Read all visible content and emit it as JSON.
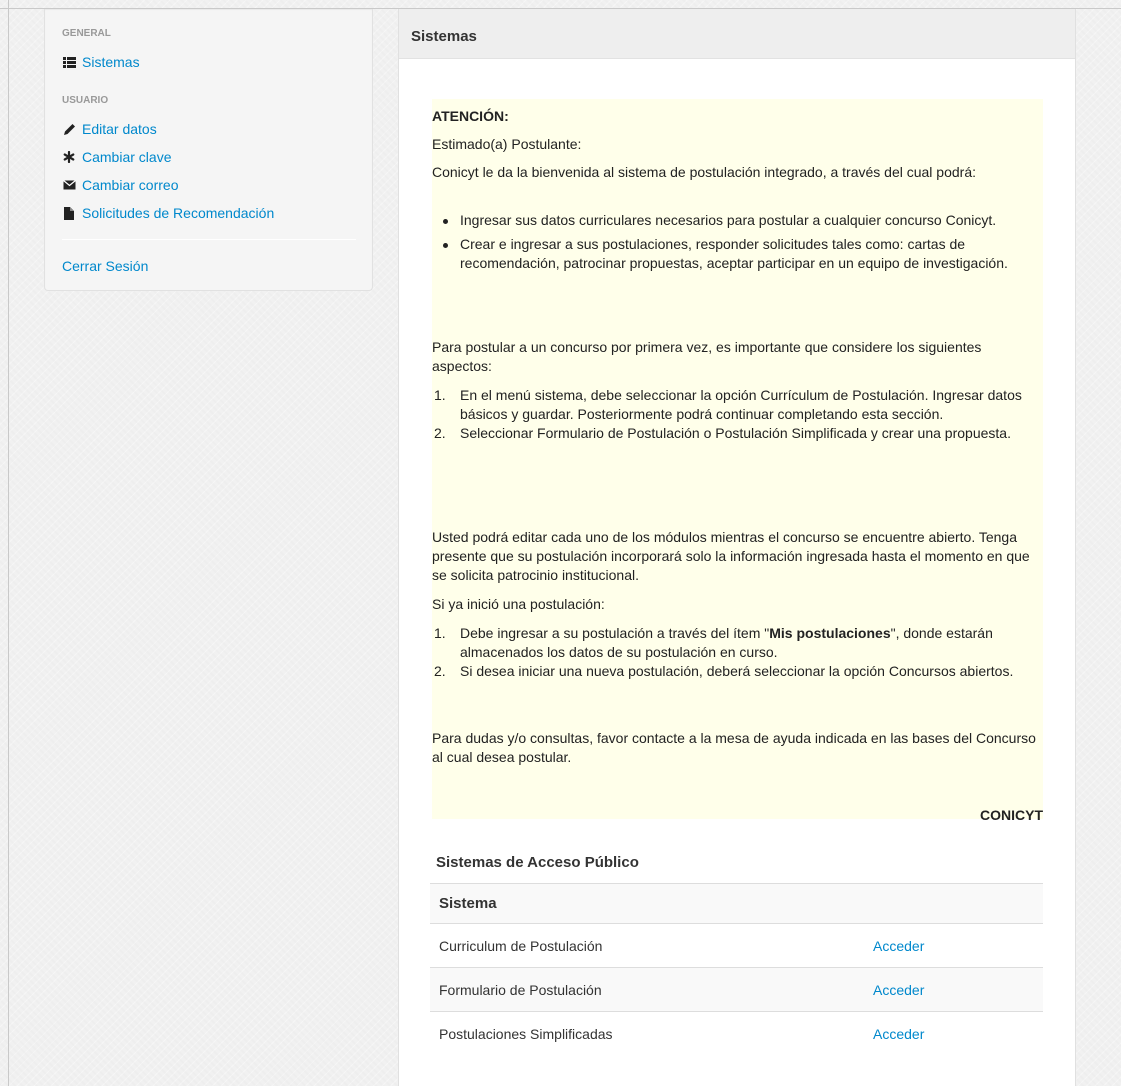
{
  "sidebar": {
    "section_general": "GENERAL",
    "sistemas": "Sistemas",
    "section_usuario": "USUARIO",
    "editar_datos": "Editar datos",
    "cambiar_clave": "Cambiar clave",
    "cambiar_correo": "Cambiar correo",
    "solicitudes": "Solicitudes de Recomendación",
    "cerrar_sesion": "Cerrar Sesión"
  },
  "panel": {
    "title": "Sistemas"
  },
  "notice": {
    "title": "ATENCIÓN:",
    "greeting": "Estimado(a) Postulante:",
    "intro": "Conicyt le da la bienvenida al sistema de postulación integrado, a través del cual podrá:",
    "bullets": [
      "Ingresar sus datos curriculares necesarios para postular a cualquier concurso Conicyt.",
      "Crear e ingresar a sus postulaciones, responder solicitudes tales como: cartas de recomendación, patrocinar propuestas, aceptar participar en un equipo de investigación."
    ],
    "first_time": "Para postular a un concurso por primera vez, es importante que considere los siguientes aspectos:",
    "steps": [
      "En el menú sistema, debe seleccionar la opción Currículum de Postulación. Ingresar datos básicos y guardar. Posteriormente podrá continuar completando esta sección.",
      "Seleccionar Formulario de Postulación o Postulación Simplificada y crear una propuesta."
    ],
    "edit_info": "Usted podrá editar cada uno de los módulos mientras el concurso se encuentre abierto. Tenga presente que su postulación incorporará solo la información ingresada hasta el momento en que se solicita patrocinio institucional.",
    "started": "Si ya inició una postulación:",
    "started_steps": [
      {
        "before": "Debe ingresar a su postulación a través del ítem \"",
        "bold": "Mis postulaciones",
        "after": "\", donde estarán almacenados los datos de su postulación en curso."
      },
      {
        "before": "Si desea iniciar una nueva postulación, deberá seleccionar la opción Concursos abiertos.",
        "bold": "",
        "after": ""
      }
    ],
    "contact": "Para dudas y/o consultas, favor contacte a la mesa de ayuda indicada en las bases del Concurso al cual desea postular.",
    "signature": "CONICYT"
  },
  "public_systems": {
    "title": "Sistemas de Acceso Público",
    "column_header": "Sistema",
    "rows": [
      {
        "name": "Curriculum de Postulación",
        "action": "Acceder"
      },
      {
        "name": "Formulario de Postulación",
        "action": "Acceder"
      },
      {
        "name": "Postulaciones Simplificadas",
        "action": "Acceder"
      }
    ]
  }
}
